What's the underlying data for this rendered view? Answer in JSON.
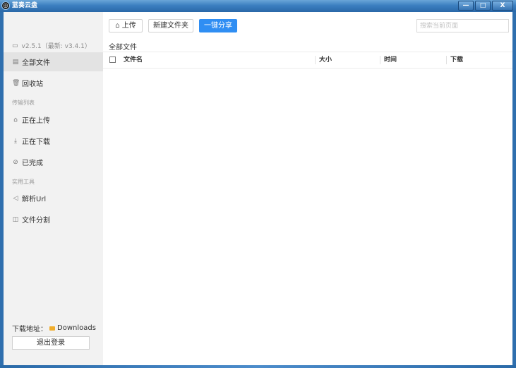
{
  "titlebar": {
    "title": "蓝奏云盘",
    "buttons": {
      "minimize": "—",
      "maximize": "□",
      "close": "X"
    }
  },
  "sidebar": {
    "version": "v2.5.1（最新: v3.4.1）",
    "items": [
      {
        "label": "全部文件",
        "icon": "folder-icon",
        "active": true
      },
      {
        "label": "回收站",
        "icon": "trash-icon"
      }
    ],
    "transfer_group": "传输列表",
    "transfer_items": [
      {
        "label": "正在上传",
        "icon": "upload-icon"
      },
      {
        "label": "正在下载",
        "icon": "download-icon"
      },
      {
        "label": "已完成",
        "icon": "check-icon"
      }
    ],
    "tools_group": "实用工具",
    "tool_items": [
      {
        "label": "解析Url",
        "icon": "send-icon"
      },
      {
        "label": "文件分割",
        "icon": "split-icon"
      }
    ],
    "download_path_label": "下载地址：",
    "download_path_value": "Downloads",
    "logout_label": "退出登录"
  },
  "toolbar": {
    "upload_label": "上传",
    "new_folder_label": "新建文件夹",
    "share_label": "一键分享",
    "search_placeholder": "搜索当前页面"
  },
  "main": {
    "breadcrumb": "全部文件",
    "columns": [
      "文件名",
      "大小",
      "时间",
      "下载"
    ]
  },
  "colors": {
    "accent": "#2f8ef3",
    "titlebar": "#3c7fc0",
    "sidebar_bg": "#f2f2f2",
    "active_item_bg": "#e3e3e3"
  }
}
